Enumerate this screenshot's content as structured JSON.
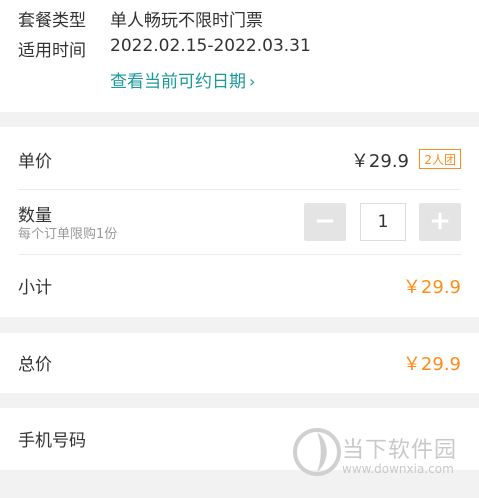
{
  "package": {
    "type_label": "套餐类型",
    "type_value": "单人畅玩不限时门票",
    "time_label": "适用时间",
    "time_value": "2022.02.15-2022.03.31",
    "link_label": "查看当前可约日期",
    "link_chevron": "›"
  },
  "order": {
    "unit_price_label": "单价",
    "unit_price_value": "￥29.9",
    "group_badge": "2人团",
    "quantity_label": "数量",
    "quantity_hint": "每个订单限购1份",
    "minus": "−",
    "quantity_value": "1",
    "plus": "+",
    "subtotal_label": "小计",
    "subtotal_value": "￥29.9"
  },
  "total": {
    "label": "总价",
    "value": "￥29.9"
  },
  "phone": {
    "label": "手机号码"
  },
  "watermark": {
    "text": "当下软件园",
    "url": "www.downxia.com"
  },
  "colors": {
    "accent": "#ff8c1a",
    "link": "#1a9a9a",
    "background": "#f2f2f2"
  }
}
